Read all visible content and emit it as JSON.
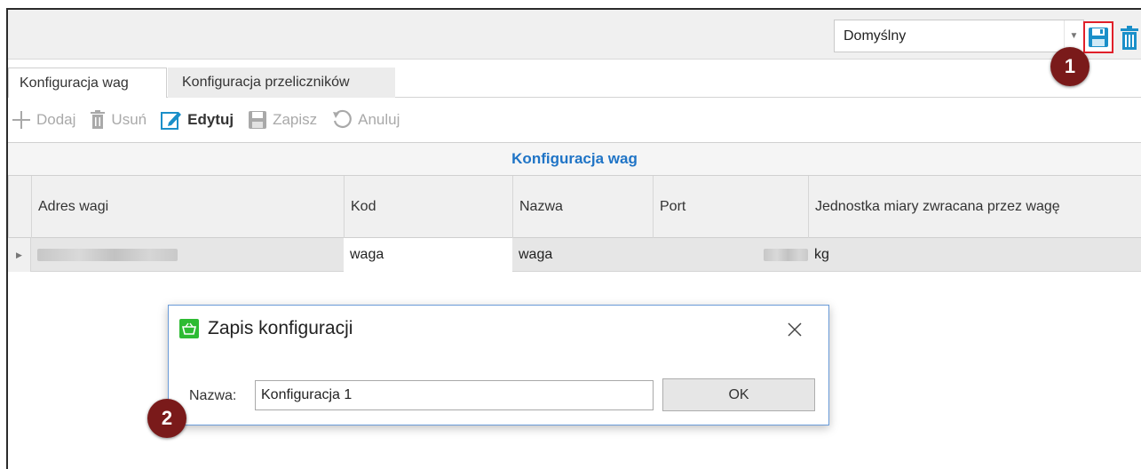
{
  "top_bar": {
    "config_selected": "Domyślny",
    "save_icon": "floppy-disk-icon",
    "delete_icon": "trash-icon",
    "accent_color": "#1a8fc9",
    "highlight_color": "#e0202a"
  },
  "markers": {
    "one": "1",
    "two": "2"
  },
  "tabs": [
    {
      "label": "Konfiguracja wag",
      "active": true
    },
    {
      "label": "Konfiguracja przeliczników",
      "active": false
    }
  ],
  "toolbar": {
    "add": "Dodaj",
    "delete": "Usuń",
    "edit": "Edytuj",
    "save": "Zapisz",
    "cancel": "Anuluj"
  },
  "grid": {
    "title": "Konfiguracja wag",
    "title_color": "#1f74c6",
    "columns": [
      "Adres wagi",
      "Kod",
      "Nazwa",
      "Port",
      "Jednostka miary zwracana przez wagę"
    ],
    "rows": [
      {
        "adres": "",
        "kod": "waga",
        "nazwa": "waga",
        "port": "",
        "jednostka": "kg"
      }
    ]
  },
  "dialog": {
    "title": "Zapis konfiguracji",
    "name_label": "Nazwa:",
    "name_value": "Konfiguracja 1",
    "ok_label": "OK"
  }
}
